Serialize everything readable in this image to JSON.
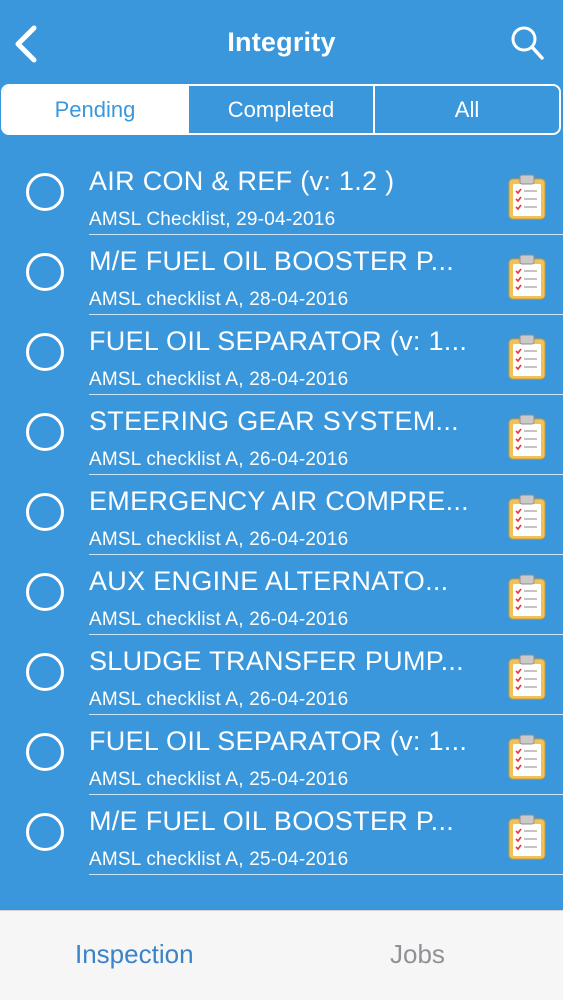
{
  "header": {
    "title": "Integrity",
    "back_icon": "chevron-left-icon",
    "search_icon": "search-icon"
  },
  "segments": [
    {
      "label": "Pending",
      "active": true
    },
    {
      "label": "Completed",
      "active": false
    },
    {
      "label": "All",
      "active": false
    }
  ],
  "items": [
    {
      "title": "AIR CON & REF (v: 1.2 )",
      "subtitle": "AMSL Checklist, 29-04-2016"
    },
    {
      "title": "M/E FUEL OIL BOOSTER P...",
      "subtitle": "AMSL checklist A, 28-04-2016"
    },
    {
      "title": "FUEL OIL SEPARATOR (v: 1...",
      "subtitle": "AMSL checklist A, 28-04-2016"
    },
    {
      "title": "STEERING GEAR SYSTEM...",
      "subtitle": "AMSL checklist A, 26-04-2016"
    },
    {
      "title": "EMERGENCY AIR COMPRE...",
      "subtitle": "AMSL checklist A, 26-04-2016"
    },
    {
      "title": "AUX ENGINE ALTERNATO...",
      "subtitle": "AMSL checklist A, 26-04-2016"
    },
    {
      "title": "SLUDGE TRANSFER PUMP...",
      "subtitle": "AMSL checklist A, 26-04-2016"
    },
    {
      "title": "FUEL OIL SEPARATOR (v: 1...",
      "subtitle": "AMSL checklist A, 25-04-2016"
    },
    {
      "title": "M/E FUEL OIL BOOSTER P...",
      "subtitle": "AMSL checklist A, 25-04-2016"
    }
  ],
  "tabbar": {
    "inspection_label": "Inspection",
    "jobs_label": "Jobs"
  },
  "colors": {
    "background": "#3b97dc",
    "active_tab": "#3b82c8",
    "inactive_tab": "#909095",
    "clipboard_board": "#f2c25a",
    "check_mark": "#e2393b"
  }
}
